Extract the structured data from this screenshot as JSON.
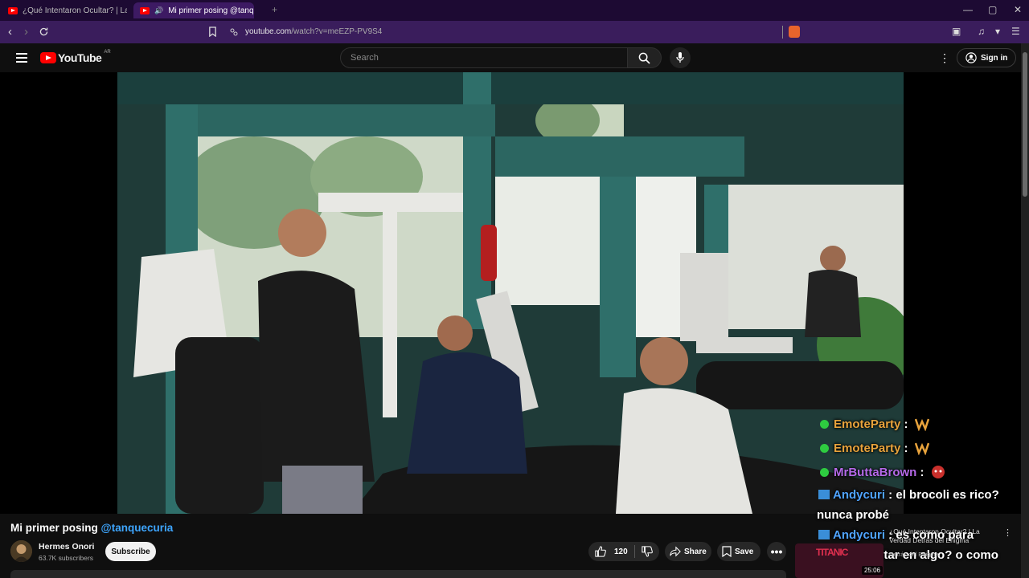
{
  "browser": {
    "tabs": [
      {
        "title": "¿Qué Intentaron Ocultar? | La Verdad",
        "active": false
      },
      {
        "title": "Mi primer posing @tanquecu",
        "active": true
      }
    ],
    "tab_close": "✕",
    "new_tab": "+",
    "url_host": "youtube.com",
    "url_path": "/watch?v=meEZP-PV9S4",
    "window": {
      "minimize": "—",
      "maximize": "▢",
      "close": "✕"
    }
  },
  "header": {
    "logo_text": "YouTube",
    "region": "AR",
    "search_placeholder": "Search",
    "signin_label": "Sign in"
  },
  "video": {
    "title_main": "Mi primer posing",
    "title_mention": "@tanquecuria",
    "channel_name": "Hermes Onori",
    "subscribers": "63.7K subscribers",
    "subscribe_label": "Subscribe",
    "like_count": "120",
    "share_label": "Share",
    "save_label": "Save"
  },
  "chat_overlay": [
    {
      "user": "EmoteParty",
      "color": "#e8a33c",
      "text": "",
      "badge": "check"
    },
    {
      "user": "EmoteParty",
      "color": "#e8a33c",
      "text": "",
      "badge": "check"
    },
    {
      "user": "MrButtaBrown",
      "color": "#b569e8",
      "text": "",
      "badge": "check"
    },
    {
      "user": "Andycuri",
      "color": "#4fa3ff",
      "text": "el brocoli es rico? nunca probé",
      "badge": "prime"
    },
    {
      "user": "Andycuri",
      "color": "#4fa3ff",
      "text": "es como para complementar en algo? o como",
      "badge": "prime"
    }
  ],
  "recommendation": {
    "title": "¿Qué Intentaron Ocultar? | La Verdad Detrás del Enigma",
    "channel": "Detrás del Enigma",
    "duration": "25:06",
    "thumb_text": "TITANIC"
  }
}
